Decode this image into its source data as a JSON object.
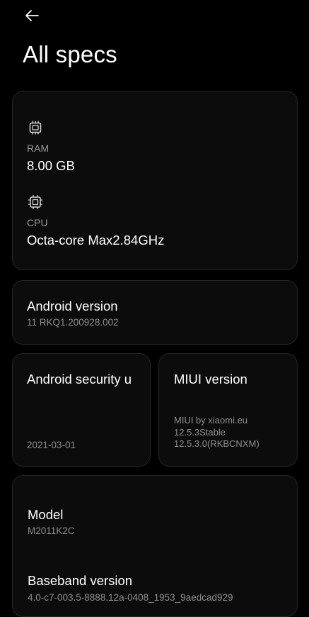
{
  "header": {
    "back_icon": "arrow-left-icon",
    "title": "All specs"
  },
  "hardware": {
    "ram": {
      "icon": "chip-icon",
      "label": "RAM",
      "value": "8.00 GB"
    },
    "cpu": {
      "icon": "processor-icon",
      "label": "CPU",
      "value": "Octa-core Max2.84GHz"
    }
  },
  "android": {
    "title": "Android version",
    "value": "11 RKQ1.200928.002"
  },
  "security": {
    "title": "Android security u",
    "value": "2021-03-01"
  },
  "miui": {
    "title": "MIUI version",
    "lines": [
      "MIUI by xiaomi.eu",
      "12.5.3Stable",
      "12.5.3.0(RKBCNXM)"
    ]
  },
  "model": {
    "title": "Model",
    "value": "M2011K2C"
  },
  "baseband": {
    "title": "Baseband version",
    "value": "4.0-c7-003.5-8888.12a-0408_1953_9aedcad929"
  },
  "colors": {
    "background": "#000000",
    "card": "#0c0c0c",
    "card_border": "#262626",
    "primary_text": "#ffffff",
    "secondary_text": "#9a9a9a"
  }
}
